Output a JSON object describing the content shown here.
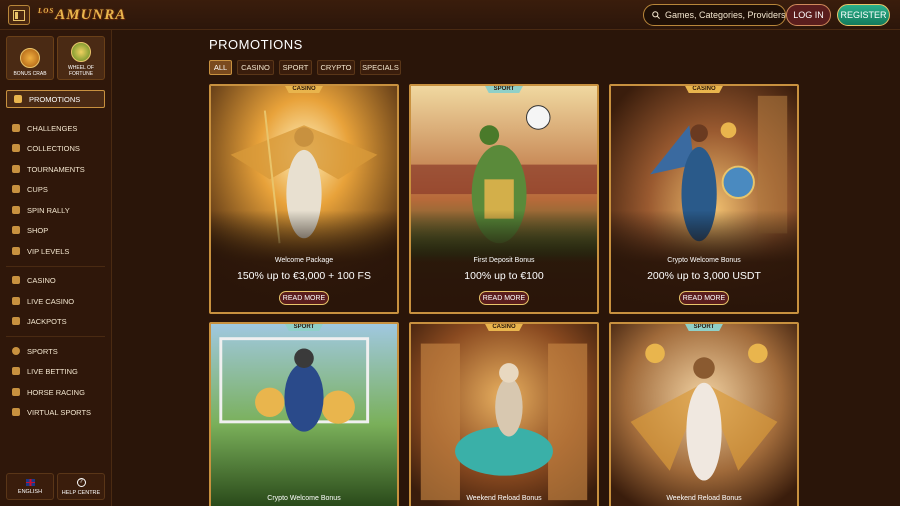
{
  "header": {
    "logo_text": "AMUNRA",
    "logo_prefix": "LOS",
    "search_placeholder": "Games, Categories, Providers",
    "login_label": "LOG IN",
    "register_label": "REGISTER"
  },
  "sidebar": {
    "tiles": [
      {
        "label": "BONUS CRAB",
        "icon": "crab-icon"
      },
      {
        "label": "WHEEL OF FORTUNE",
        "icon": "wheel-icon"
      }
    ],
    "active_item": "PROMOTIONS",
    "group1": [
      "CHALLENGES",
      "COLLECTIONS",
      "TOURNAMENTS",
      "CUPS",
      "SPIN RALLY",
      "SHOP",
      "VIP LEVELS"
    ],
    "group2": [
      "CASINO",
      "LIVE CASINO",
      "JACKPOTS"
    ],
    "group3": [
      "SPORTS",
      "LIVE BETTING",
      "HORSE RACING",
      "VIRTUAL SPORTS"
    ],
    "bottom": {
      "language": "ENGLISH",
      "help": "HELP CENTRE"
    }
  },
  "main": {
    "title": "PROMOTIONS",
    "filters": [
      "ALL",
      "CASINO",
      "SPORT",
      "CRYPTO",
      "SPECIALS"
    ],
    "active_filter": "ALL",
    "cards": [
      {
        "badge": "CASINO",
        "subtitle": "Welcome Package",
        "title": "150% up to €3,000 + 100 FS",
        "button": "READ MORE"
      },
      {
        "badge": "SPORT",
        "subtitle": "First Deposit Bonus",
        "title": "100% up to €100",
        "button": "READ MORE"
      },
      {
        "badge": "CASINO",
        "subtitle": "Crypto Welcome Bonus",
        "title": "200% up to 3,000 USDT",
        "button": "READ MORE"
      },
      {
        "badge": "SPORT",
        "subtitle": "Crypto Welcome Bonus"
      },
      {
        "badge": "CASINO",
        "subtitle": "Weekend Reload Bonus"
      },
      {
        "badge": "SPORT",
        "subtitle": "Weekend Reload Bonus"
      }
    ]
  },
  "colors": {
    "background": "#2a1509",
    "gold_border": "#c8913f",
    "register_green": "#1f9c78",
    "login_maroon": "#5a1d1d"
  }
}
